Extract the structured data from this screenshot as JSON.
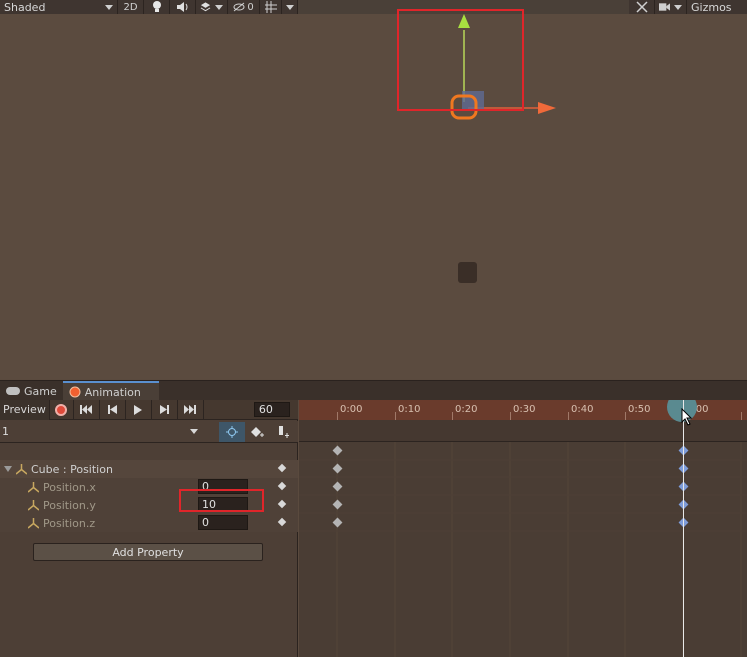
{
  "scene_toolbar": {
    "shading_mode": "Shaded",
    "mode_2d": "2D",
    "hidden_count": "0",
    "gizmos": "Gizmos"
  },
  "tabs": [
    {
      "label": "Game",
      "active": false
    },
    {
      "label": "Animation",
      "active": true
    }
  ],
  "animation": {
    "preview_label": "Preview",
    "frame": "60",
    "clip_name": "1",
    "property_group": "Cube : Position",
    "properties": [
      {
        "label": "Position.x",
        "value": "0"
      },
      {
        "label": "Position.y",
        "value": "10"
      },
      {
        "label": "Position.z",
        "value": "0"
      }
    ],
    "add_property_label": "Add Property",
    "ruler_labels": [
      "0:00",
      "0:10",
      "0:20",
      "0:30",
      "0:40",
      "0:50",
      "1:00"
    ]
  },
  "colors": {
    "record": "#e04a3a",
    "selection_box": "#e0252a",
    "keyframe_selected": "#7e9cd8",
    "ruler": "#6a3b2c"
  }
}
